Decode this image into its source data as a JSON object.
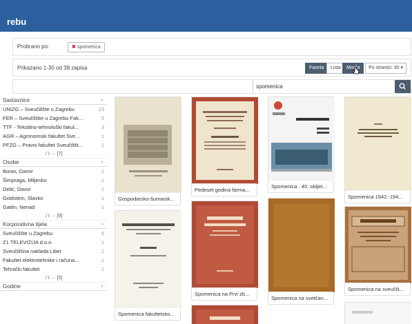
{
  "header": {
    "title": "rebu"
  },
  "filter": {
    "label": "Probrano po:",
    "chip": "spomenica"
  },
  "results": {
    "count_text": "Prikazano 1-30 od 38 zapisa",
    "buttons": [
      "Faseta",
      "Lista",
      "Mreža"
    ],
    "per_page": "Po stranici: 30 ▾"
  },
  "search": {
    "value": "spomenica"
  },
  "sidebar": {
    "sections": [
      {
        "title": "Sastavnice",
        "items": [
          {
            "label": "UNIZG – Sveučilište u Zagrebu",
            "count": "23"
          },
          {
            "label": "FER – Sveučilište u Zagrebu Fak...",
            "count": "5"
          },
          {
            "label": "TTF - Tekstilno-tehnološki fakul...",
            "count": "3"
          },
          {
            "label": "AGR – Agronomski fakultet Sve...",
            "count": "1"
          },
          {
            "label": "PFZG – Pravni fakultet Sveučilišt...",
            "count": "1"
          }
        ],
        "more": "↓̄  ⅰ  ··· [7]"
      },
      {
        "title": "Osobe",
        "items": [
          {
            "label": "Boras, Damir",
            "count": "1"
          },
          {
            "label": "Šimpraga, Miljenko",
            "count": "1"
          },
          {
            "label": "Delić, Davor",
            "count": "1"
          },
          {
            "label": "Goldstein, Slavko",
            "count": "1"
          },
          {
            "label": "Gattin, Nenad",
            "count": "1"
          }
        ],
        "more": "↓̄  ⅰ  ··· [9]"
      },
      {
        "title": "Korporativna tijela",
        "items": [
          {
            "label": "Sveučilište u Zagrebu",
            "count": "6"
          },
          {
            "label": "Z1 TELEVIZIJA d.o.o.",
            "count": "1"
          },
          {
            "label": "Sveučilišna naklada Liber",
            "count": "1"
          },
          {
            "label": "Fakultet elektrotehnike i računa...",
            "count": "1"
          },
          {
            "label": "Tehnički fakultet",
            "count": "1"
          }
        ],
        "more": "↓̄  ⅰ  ··· [5]"
      },
      {
        "title": "Godine",
        "items": [],
        "more": ""
      }
    ]
  },
  "cards": [
    {
      "caption": "Gospodarsko-šumarsk...",
      "cover_text": ""
    },
    {
      "caption": "Pedeset godina farma...",
      "cover_text": "PEDESET GODINA FARMACEUTSKE NASTAVE NA ZAGREBAČKOM SVEUČILIŠTU 1882–1932 SPOMENICA"
    },
    {
      "caption": "Spomenica : 40. obljet...",
      "cover_text": "SPOMENICA 1956 1996"
    },
    {
      "caption": "Spomenica 1942.-194...",
      "cover_text": "TEHNIČKI FAKULTET HRVATSKOG SVEUČILIŠTA U ZAGREBU"
    },
    {
      "caption": "Spomenica fakultetsko...",
      "cover_text": "TEHNIČKI FAKULTET SVEUČILIŠTA KRALJEVINE JUGOSLAVIJE ZAGREB 1919–1929"
    },
    {
      "caption": "Spomenica na Prvi zb...",
      "cover_text": "SPOMENICA NA PRVI ZBOR PRAVNIKA"
    },
    {
      "caption": "Spomenica na svetčan...",
      "cover_text": ""
    },
    {
      "caption": "Spomenica na sveučili...",
      "cover_text": "SPOMENICA"
    },
    {
      "caption": "",
      "cover_text": "SPOMENICA"
    }
  ],
  "colors": {
    "topbar": "#2c5f9e",
    "button_dark": "#4d5d70"
  }
}
